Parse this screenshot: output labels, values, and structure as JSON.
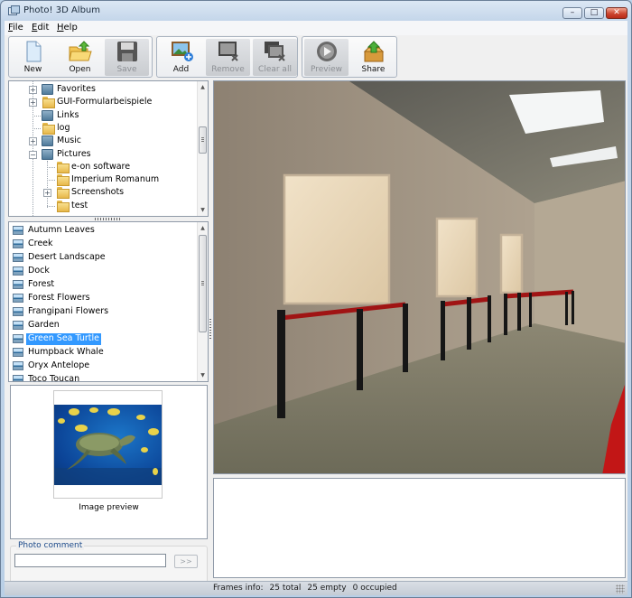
{
  "window": {
    "title": "Photo! 3D Album",
    "controls": {
      "minimize": "–",
      "maximize": "□",
      "close": "✕"
    }
  },
  "menubar": {
    "items": [
      {
        "label": "File",
        "accel": "F",
        "rest": "ile"
      },
      {
        "label": "Edit",
        "accel": "E",
        "rest": "dit"
      },
      {
        "label": "Help",
        "accel": "H",
        "rest": "elp"
      }
    ]
  },
  "toolbar": {
    "groups": [
      [
        {
          "label": "New",
          "icon": "new-document-icon",
          "enabled": true
        },
        {
          "label": "Open",
          "icon": "open-folder-icon",
          "enabled": true
        },
        {
          "label": "Save",
          "icon": "save-disk-icon",
          "enabled": false
        }
      ],
      [
        {
          "label": "Add",
          "icon": "add-picture-icon",
          "enabled": true
        },
        {
          "label": "Remove",
          "icon": "remove-picture-icon",
          "enabled": false
        },
        {
          "label": "Clear all",
          "icon": "clear-all-icon",
          "enabled": false
        }
      ],
      [
        {
          "label": "Preview",
          "icon": "play-icon",
          "enabled": false
        },
        {
          "label": "Share",
          "icon": "share-box-icon",
          "enabled": true
        }
      ]
    ]
  },
  "folder_tree": {
    "items": [
      {
        "label": "Favorites",
        "level": 0,
        "expander": "+",
        "icon": "favorites-folder-icon"
      },
      {
        "label": "GUI-Formularbeispiele",
        "level": 0,
        "expander": "+",
        "icon": "folder-icon"
      },
      {
        "label": "Links",
        "level": 0,
        "expander": "",
        "icon": "links-folder-icon"
      },
      {
        "label": "log",
        "level": 0,
        "expander": "",
        "icon": "folder-icon"
      },
      {
        "label": "Music",
        "level": 0,
        "expander": "+",
        "icon": "music-folder-icon"
      },
      {
        "label": "Pictures",
        "level": 0,
        "expander": "−",
        "icon": "pictures-folder-icon"
      },
      {
        "label": "e-on software",
        "level": 1,
        "expander": "",
        "icon": "folder-icon"
      },
      {
        "label": "Imperium Romanum",
        "level": 1,
        "expander": "",
        "icon": "folder-icon"
      },
      {
        "label": "Screenshots",
        "level": 1,
        "expander": "+",
        "icon": "folder-icon"
      },
      {
        "label": "test",
        "level": 1,
        "expander": "",
        "icon": "folder-icon"
      }
    ]
  },
  "file_list": {
    "items": [
      "Autumn Leaves",
      "Creek",
      "Desert Landscape",
      "Dock",
      "Forest",
      "Forest Flowers",
      "Frangipani Flowers",
      "Garden",
      "Green Sea Turtle",
      "Humpback Whale",
      "Oryx Antelope",
      "Toco Toucan"
    ],
    "selected": "Green Sea Turtle"
  },
  "preview": {
    "caption": "Image preview",
    "image_subject": "green sea turtle with yellow fish"
  },
  "photo_comment": {
    "legend": "Photo comment",
    "value": "",
    "button_label": ">>"
  },
  "status": {
    "label": "Frames info:",
    "total": "25 total",
    "empty": "25 empty",
    "occupied": "0 occupied"
  },
  "colors": {
    "selection": "#3399ff",
    "rope": "#b01818",
    "wall": "#a89a88"
  }
}
